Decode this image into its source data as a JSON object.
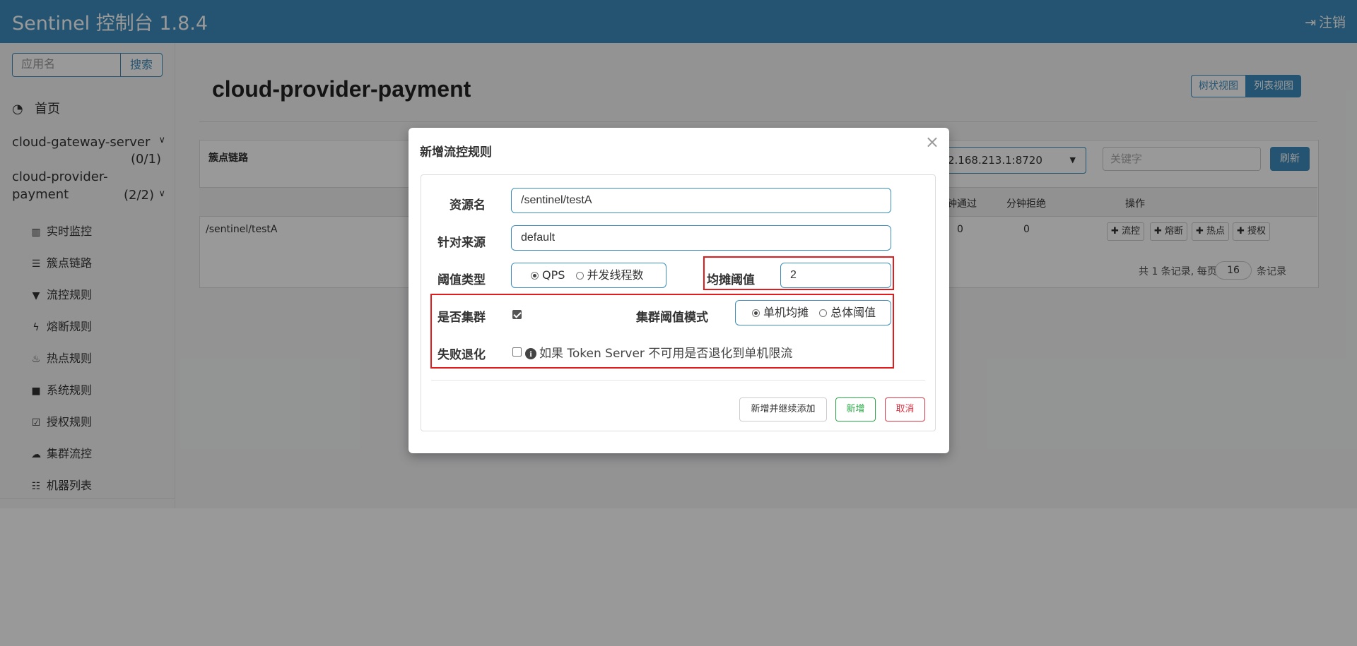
{
  "header": {
    "brand": "Sentinel 控制台 1.8.4",
    "logout": "注销",
    "color": "#3c8dbc"
  },
  "sidebar": {
    "search_placeholder": "应用名",
    "search_button": "搜索",
    "home": "首页",
    "apps": [
      {
        "name": "cloud-gateway-server",
        "count": "(0/1)"
      },
      {
        "name_line1": "cloud-provider-",
        "name_line2": "payment",
        "count": "(2/2)"
      }
    ],
    "menu": [
      {
        "label": "实时监控",
        "icon": "bar-chart-icon"
      },
      {
        "label": "簇点链路",
        "icon": "list-alt-icon"
      },
      {
        "label": "流控规则",
        "icon": "filter-icon"
      },
      {
        "label": "熔断规则",
        "icon": "flash-icon"
      },
      {
        "label": "热点规则",
        "icon": "fire-icon"
      },
      {
        "label": "系统规则",
        "icon": "lock-icon"
      },
      {
        "label": "授权规则",
        "icon": "check-icon"
      },
      {
        "label": "集群流控",
        "icon": "cloud-icon"
      },
      {
        "label": "机器列表",
        "icon": "th-list-icon"
      }
    ]
  },
  "main": {
    "page_title": "cloud-provider-payment",
    "view_tree": "树状视图",
    "view_list": "列表视图",
    "panel_title": "簇点链路",
    "machine": "2.168.213.1:8720",
    "keyword_placeholder": "关键字",
    "refresh": "刷新",
    "columns": {
      "pass": "钟通过",
      "reject": "分钟拒绝",
      "ops": "操作"
    },
    "row": {
      "resource": "/sentinel/testA",
      "pass": "0",
      "reject": "0"
    },
    "ops": [
      "流控",
      "熔断",
      "热点",
      "授权"
    ],
    "pager": {
      "prefix": "共 1 条记录, 每页",
      "page_size": "16",
      "suffix": "条记录"
    }
  },
  "modal": {
    "title": "新增流控规则",
    "close": "×",
    "resource_label": "资源名",
    "resource_value": "/sentinel/testA",
    "origin_label": "针对来源",
    "origin_value": "default",
    "threshold_type_label": "阈值类型",
    "threshold_type_options": [
      "QPS",
      "并发线程数"
    ],
    "threshold_type_selected": "QPS",
    "avg_threshold_label": "均摊阈值",
    "avg_threshold_value": "2",
    "cluster_label": "是否集群",
    "cluster_checked": true,
    "cluster_mode_label": "集群阈值模式",
    "cluster_mode_options": [
      "单机均摊",
      "总体阈值"
    ],
    "cluster_mode_selected": "单机均摊",
    "fallback_label": "失败退化",
    "fallback_checked": false,
    "fallback_hint": "如果 Token Server 不可用是否退化到单机限流",
    "btn_add_more": "新增并继续添加",
    "btn_add": "新增",
    "btn_cancel": "取消",
    "highlight_color": "#e21c1c"
  }
}
